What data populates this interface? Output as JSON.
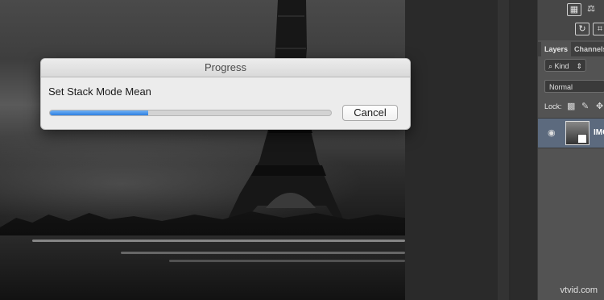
{
  "dialog": {
    "title": "Progress",
    "message": "Set Stack Mode Mean",
    "progress": 0.35,
    "cancel_label": "Cancel"
  },
  "layers_panel": {
    "tabs": [
      "Layers",
      "Channels"
    ],
    "filter_label": "Kind",
    "blend_mode": "Normal",
    "lock_label": "Lock:",
    "layer_name": "IMG"
  },
  "watermark": "vtvid.com",
  "colors": {
    "progress_fill": "#2d7fe0",
    "selected_layer_bg": "#5c6a7e",
    "panel_bg": "#535353"
  },
  "icons": [
    "eiffel-tower-photo",
    "tool-icon",
    "scales-icon",
    "swap-icon",
    "crop-icon",
    "search-filter-icon",
    "lock-transparency-icon",
    "lock-brush-icon",
    "lock-move-icon",
    "eye-icon",
    "layer-thumbnail"
  ]
}
